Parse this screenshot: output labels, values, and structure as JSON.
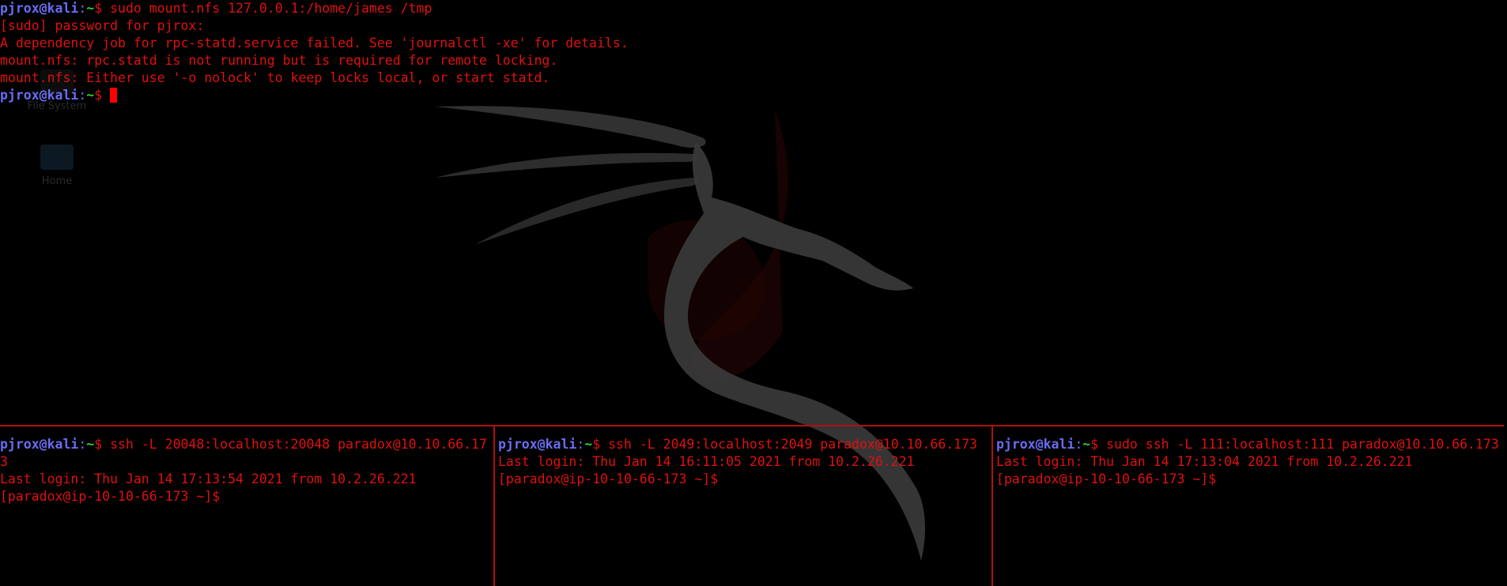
{
  "desktop": {
    "icons": [
      {
        "label": "File System",
        "icon": "drive-icon"
      },
      {
        "label": "Home",
        "icon": "home-folder-icon"
      }
    ]
  },
  "colors": {
    "user": "#6a6cf0",
    "path": "#2fd12f",
    "text": "#e01010",
    "divider": "#b01010",
    "background": "#000000"
  },
  "top_pane": {
    "prompt": {
      "user": "pjrox@kali",
      "sep": ":",
      "path": "~",
      "sym": "$ "
    },
    "command": "sudo mount.nfs 127.0.0.1:/home/james /tmp",
    "output": [
      "[sudo] password for pjrox:",
      "A dependency job for rpc-statd.service failed. See 'journalctl -xe' for details.",
      "mount.nfs: rpc.statd is not running but is required for remote locking.",
      "mount.nfs: Either use '-o nolock' to keep locks local, or start statd."
    ]
  },
  "bottom_panes": [
    {
      "prompt": {
        "user": "pjrox@kali",
        "sep": ":",
        "path": "~",
        "sym": "$ "
      },
      "command": "ssh -L 20048:localhost:20048 paradox@10.10.66.173",
      "last_login": "Last login: Thu Jan 14 17:13:54 2021 from 10.2.26.221",
      "remote_prompt": "[paradox@ip-10-10-66-173 ~]$"
    },
    {
      "prompt": {
        "user": "pjrox@kali",
        "sep": ":",
        "path": "~",
        "sym": "$ "
      },
      "command": "ssh -L 2049:localhost:2049 paradox@10.10.66.173",
      "last_login": "Last login: Thu Jan 14 16:11:05 2021 from 10.2.26.221",
      "remote_prompt": "[paradox@ip-10-10-66-173 ~]$"
    },
    {
      "prompt": {
        "user": "pjrox@kali",
        "sep": ":",
        "path": "~",
        "sym": "$ "
      },
      "command": "sudo ssh -L 111:localhost:111 paradox@10.10.66.173",
      "last_login": "Last login: Thu Jan 14 17:13:04 2021 from 10.2.26.221",
      "remote_prompt": "[paradox@ip-10-10-66-173 ~]$"
    }
  ]
}
